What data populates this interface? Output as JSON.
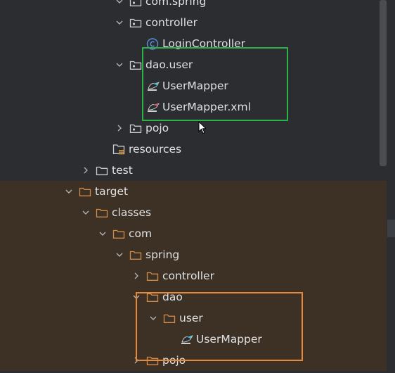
{
  "tree": [
    {
      "label": "com.spring",
      "arrow": "down",
      "icon": "package-folder-icon",
      "target": false
    },
    {
      "label": "controller",
      "arrow": "down",
      "icon": "package-folder-icon",
      "target": false
    },
    {
      "label": "LoginController",
      "arrow": "none",
      "icon": "java-class-icon",
      "target": false
    },
    {
      "label": "dao.user",
      "arrow": "down",
      "icon": "package-folder-icon",
      "target": false
    },
    {
      "label": "UserMapper",
      "arrow": "none",
      "icon": "mybatis-mapper-icon",
      "target": false
    },
    {
      "label": "UserMapper.xml",
      "arrow": "none",
      "icon": "mybatis-xml-icon",
      "target": false
    },
    {
      "label": "pojo",
      "arrow": "right",
      "icon": "package-folder-icon",
      "target": false
    },
    {
      "label": "resources",
      "arrow": "none",
      "icon": "resources-folder-icon",
      "target": false
    },
    {
      "label": "test",
      "arrow": "right",
      "icon": "folder-icon",
      "target": false
    },
    {
      "label": "target",
      "arrow": "down",
      "icon": "excluded-folder-icon",
      "target": true
    },
    {
      "label": "classes",
      "arrow": "down",
      "icon": "excluded-folder-icon",
      "target": true
    },
    {
      "label": "com",
      "arrow": "down",
      "icon": "excluded-folder-icon",
      "target": true
    },
    {
      "label": "spring",
      "arrow": "down",
      "icon": "excluded-folder-icon",
      "target": true
    },
    {
      "label": "controller",
      "arrow": "right",
      "icon": "excluded-folder-icon",
      "target": true
    },
    {
      "label": "dao",
      "arrow": "down",
      "icon": "excluded-folder-icon",
      "target": true
    },
    {
      "label": "user",
      "arrow": "down",
      "icon": "excluded-folder-icon",
      "target": true
    },
    {
      "label": "UserMapper",
      "arrow": "none",
      "icon": "class-file-icon",
      "target": true
    },
    {
      "label": "pojo",
      "arrow": "right",
      "icon": "excluded-folder-icon",
      "target": true
    }
  ],
  "colors": {
    "background": "#2b2d30",
    "excluded_background": "#3c3124",
    "text": "#dfe1e5",
    "excluded_folder": "#d08a4a",
    "highlight_green": "#2db14a",
    "highlight_orange": "#e8893a"
  }
}
